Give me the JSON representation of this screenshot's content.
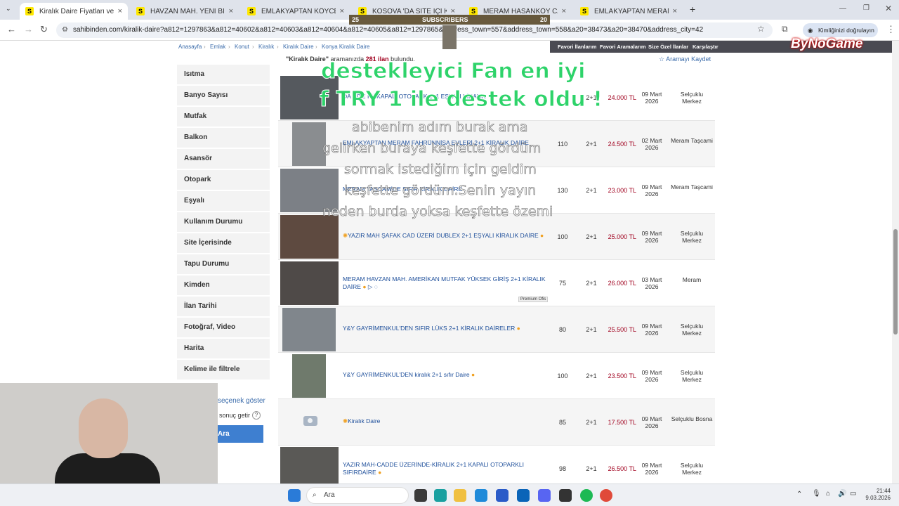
{
  "browser": {
    "tabs": [
      {
        "label": "Kiralık Daire Fiyatları ve Kiralık E",
        "active": true
      },
      {
        "label": "HAVZAN MAH. YENİ BİNADA Bİ"
      },
      {
        "label": "EMLAKYAPTAN KÖYCEĞİZ MER"
      },
      {
        "label": "KOSOVA 'DA SİTE İÇİ KAPALI OT"
      },
      {
        "label": "MERAM HASANKÖY CADDESİN"
      },
      {
        "label": "EMLAKYAPTAN MERAM FAHRÜ"
      }
    ],
    "favicon_letter": "S",
    "new_tab": "+",
    "url": "sahibinden.com/kiralik-daire?a812=1297863&a812=40602&a812=40603&a812=40604&a812=40605&a812=1297865&address_town=557&address_town=558&a20=38473&a20=38470&address_city=42",
    "identity_button": "Kimliğinizi doğrulayın"
  },
  "breadcrumb": [
    "Anasayfa",
    "Emlak",
    "Konut",
    "Kiralık",
    "Kiralık Daire",
    "Konya Kiralık Daire"
  ],
  "header_links": [
    "Favori İlanlarım",
    "Favori Aramalarım",
    "Size Özel İlanlar",
    "Karşılaştır"
  ],
  "results": {
    "query": "\"Kiralık Daire\"",
    "mid_text": "aramanızda",
    "count": "281 ilan",
    "end_text": "bulundu.",
    "save_search": "Aramayı Kaydet"
  },
  "sidebar": {
    "items": [
      "Isıtma",
      "Banyo Sayısı",
      "Mutfak",
      "Balkon",
      "Asansör",
      "Otopark",
      "Eşyalı",
      "Kullanım Durumu",
      "Site İçerisinde",
      "Tapu Durumu",
      "Kimden",
      "İlan Tarihi",
      "Fotoğraf, Video",
      "Harita",
      "Kelime ile filtrele"
    ],
    "more_options": "seçenek göster",
    "result_option": "sonuç getir",
    "help": "?",
    "search_button": "Ara"
  },
  "listings": [
    {
      "title": "DA SİTE İÇİ KAPALI OTOPARK 2+1 EŞYALI KİRALIK",
      "m2": "",
      "rooms": "2+1",
      "price": "24.000 TL",
      "date": "09 Mart 2026",
      "location": "Selçuklu Merkez"
    },
    {
      "title": "EMLAKYAPTAN MERAM FAHRÜNNİSA EVLERİ 2+1 KİRALIK DAİRE",
      "m2": "110",
      "rooms": "2+1",
      "price": "24.500 TL",
      "date": "02 Mart 2026",
      "location": "Meram Taşcami"
    },
    {
      "title": "MERAM TAŞCAMİDE SIFIR KİRALIK DAİRE",
      "m2": "130",
      "rooms": "2+1",
      "price": "23.000 TL",
      "date": "09 Mart 2026",
      "location": "Meram Taşcami"
    },
    {
      "title": "YAZIR MAH ŞAFAK CAD ÜZERİ DUBLEX 2+1 EŞYALI KİRALIK DAİRE",
      "m2": "100",
      "rooms": "2+1",
      "price": "25.000 TL",
      "date": "09 Mart 2026",
      "location": "Selçuklu Merkez"
    },
    {
      "title": "MERAM HAVZAN MAH. AMERİKAN MUTFAK YÜKSEK GİRİŞ 2+1 KİRALIK DAİRE",
      "m2": "75",
      "rooms": "2+1",
      "price": "26.000 TL",
      "date": "03 Mart 2026",
      "location": "Meram",
      "badge": "Premium Ofis"
    },
    {
      "title": "Y&Y GAYRİMENKUL'DEN SIFIR LÜKS 2+1 KİRALIK DAİRELER",
      "m2": "80",
      "rooms": "2+1",
      "price": "25.500 TL",
      "date": "09 Mart 2026",
      "location": "Selçuklu Merkez"
    },
    {
      "title": "Y&Y GAYRİMENKUL'DEN kiralık 2+1 sıfır Daire",
      "m2": "100",
      "rooms": "2+1",
      "price": "23.500 TL",
      "date": "09 Mart 2026",
      "location": "Selçuklu Merkez"
    },
    {
      "title": "Kiralık Daire",
      "m2": "85",
      "rooms": "2+1",
      "price": "17.500 TL",
      "date": "09 Mart 2026",
      "location": "Selçuklu Bosna"
    },
    {
      "title": "YAZIR MAH-CADDE ÜZERİNDE-KİRALIK 2+1 KAPALI OTOPARKLI SIFIRDAİRE",
      "m2": "98",
      "rooms": "2+1",
      "price": "26.500 TL",
      "date": "09 Mart 2026",
      "location": "Selçuklu Merkez"
    }
  ],
  "stream": {
    "subscribers_left": "25",
    "subscribers_label": "SUBSCRIBERS",
    "subscribers_right": "20",
    "logo": "ByNoGame",
    "donation_line1": "destekleyici Fan en iyi",
    "donation_line2": "f TRY 1 ile destek oldu !",
    "message_lines": [
      "abibenim adım burak ama",
      "gelirken buraya keşfette gördüm",
      "sormak istediğim için geldim",
      "keşfette gördüm.Senin yayın",
      "neden burda yoksa keşfette özemi"
    ]
  },
  "taskbar": {
    "search": "Ara",
    "time": "21:44",
    "date": "9.03.2026"
  },
  "colors": {
    "accent": "#3e7fd0",
    "price": "#a0001e",
    "link": "#1d4e9a",
    "brand_yellow": "#ffe800",
    "overlay_green": "#2ed36a"
  }
}
